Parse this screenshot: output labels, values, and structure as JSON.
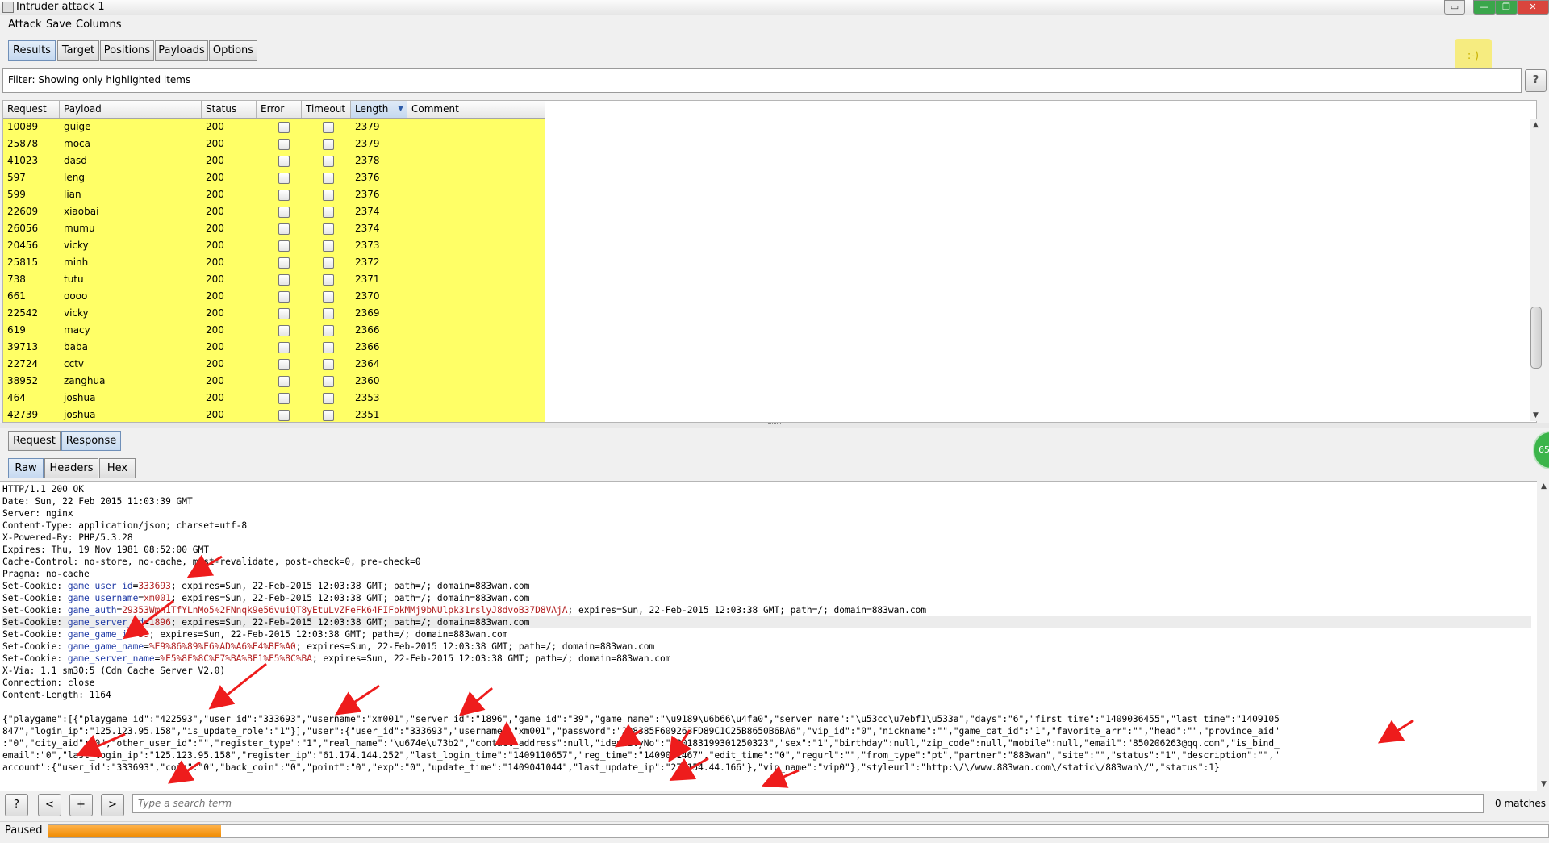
{
  "window": {
    "title": "Intruder attack 1"
  },
  "menu": [
    "Attack",
    "Save",
    "Columns"
  ],
  "tabs": [
    "Results",
    "Target",
    "Positions",
    "Payloads",
    "Options"
  ],
  "active_tab": "Results",
  "smiley": ":-)",
  "filter": {
    "text": "Filter: Showing only highlighted items",
    "help": "?"
  },
  "table": {
    "columns": [
      "Request",
      "Payload",
      "Status",
      "Error",
      "Timeout",
      "Length",
      "Comment"
    ],
    "sort_indicator": "▼",
    "highlight_color": "#ffff66",
    "rows": [
      {
        "request": "10089",
        "payload": "guige",
        "status": "200",
        "length": "2379"
      },
      {
        "request": "25878",
        "payload": "moca",
        "status": "200",
        "length": "2379"
      },
      {
        "request": "41023",
        "payload": "dasd",
        "status": "200",
        "length": "2378"
      },
      {
        "request": "597",
        "payload": "leng",
        "status": "200",
        "length": "2376"
      },
      {
        "request": "599",
        "payload": "lian",
        "status": "200",
        "length": "2376"
      },
      {
        "request": "22609",
        "payload": "xiaobai",
        "status": "200",
        "length": "2374"
      },
      {
        "request": "26056",
        "payload": "mumu",
        "status": "200",
        "length": "2374"
      },
      {
        "request": "20456",
        "payload": "vicky",
        "status": "200",
        "length": "2373"
      },
      {
        "request": "25815",
        "payload": "minh",
        "status": "200",
        "length": "2372"
      },
      {
        "request": "738",
        "payload": "tutu",
        "status": "200",
        "length": "2371"
      },
      {
        "request": "661",
        "payload": "oooo",
        "status": "200",
        "length": "2370"
      },
      {
        "request": "22542",
        "payload": "vicky",
        "status": "200",
        "length": "2369"
      },
      {
        "request": "619",
        "payload": "macy",
        "status": "200",
        "length": "2366"
      },
      {
        "request": "39713",
        "payload": "baba",
        "status": "200",
        "length": "2366"
      },
      {
        "request": "22724",
        "payload": "cctv",
        "status": "200",
        "length": "2364"
      },
      {
        "request": "38952",
        "payload": "zanghua",
        "status": "200",
        "length": "2360"
      },
      {
        "request": "464",
        "payload": "joshua",
        "status": "200",
        "length": "2353"
      },
      {
        "request": "42739",
        "payload": "joshua",
        "status": "200",
        "length": "2351"
      }
    ]
  },
  "lower_tabs": [
    "Request",
    "Response"
  ],
  "lower_active": "Response",
  "view_tabs": [
    "Raw",
    "Headers",
    "Hex"
  ],
  "view_active": "Raw",
  "badge": "65",
  "response": {
    "lines": [
      {
        "t": "HTTP/1.1 200 OK"
      },
      {
        "t": "Date: Sun, 22 Feb 2015 11:03:39 GMT"
      },
      {
        "t": "Server: nginx"
      },
      {
        "t": "Content-Type: application/json; charset=utf-8"
      },
      {
        "t": "X-Powered-By: PHP/5.3.28"
      },
      {
        "t": "Expires: Thu, 19 Nov 1981 08:52:00 GMT"
      },
      {
        "t": "Cache-Control: no-store, no-cache, must-revalidate, post-check=0, pre-check=0"
      },
      {
        "t": "Pragma: no-cache"
      },
      {
        "p": "Set-Cookie: ",
        "k": "game_user_id",
        "e": "=",
        "v": "333693",
        "s": "; expires=Sun, 22-Feb-2015 12:03:38 GMT; path=/; domain=883wan.com"
      },
      {
        "p": "Set-Cookie: ",
        "k": "game_username",
        "e": "=",
        "v": "xm001",
        "s": "; expires=Sun, 22-Feb-2015 12:03:38 GMT; path=/; domain=883wan.com"
      },
      {
        "p": "Set-Cookie: ",
        "k": "game_auth",
        "e": "=",
        "v": "29353WmH1TfYLnMo5%2FNnqk9e56vuiQT8yEtuLvZFeFk64FIFpkMMj9bNUlpk31rslyJ8dvoB37D8VAjA",
        "s": "; expires=Sun, 22-Feb-2015 12:03:38 GMT; path=/; domain=883wan.com"
      },
      {
        "p": "Set-Cookie: ",
        "k": "game_server_id",
        "e": "=",
        "v": "1896",
        "s": "; expires=Sun, 22-Feb-2015 12:03:38 GMT; path=/; domain=883wan.com",
        "hl": true
      },
      {
        "p": "Set-Cookie: ",
        "k": "game_game_id",
        "e": "=",
        "v": "39",
        "s": "; expires=Sun, 22-Feb-2015 12:03:38 GMT; path=/; domain=883wan.com"
      },
      {
        "p": "Set-Cookie: ",
        "k": "game_game_name",
        "e": "=",
        "v": "%E9%86%89%E6%AD%A6%E4%BE%A0",
        "s": "; expires=Sun, 22-Feb-2015 12:03:38 GMT; path=/; domain=883wan.com"
      },
      {
        "p": "Set-Cookie: ",
        "k": "game_server_name",
        "e": "=",
        "v": "%E5%8F%8C%E7%BA%BF1%E5%8C%BA",
        "s": "; expires=Sun, 22-Feb-2015 12:03:38 GMT; path=/; domain=883wan.com"
      },
      {
        "t": "X-Via: 1.1 sm30:5 (Cdn Cache Server V2.0)"
      },
      {
        "t": "Connection: close"
      },
      {
        "t": "Content-Length: 1164"
      },
      {
        "t": ""
      },
      {
        "t": "{\"playgame\":[{\"playgame_id\":\"422593\",\"user_id\":\"333693\",\"username\":\"xm001\",\"server_id\":\"1896\",\"game_id\":\"39\",\"game_name\":\"\\u9189\\u6b66\\u4fa0\",\"server_name\":\"\\u53cc\\u7ebf1\\u533a\",\"days\":\"6\",\"first_time\":\"1409036455\",\"last_time\":\"1409105"
      },
      {
        "t": "847\",\"login_ip\":\"125.123.95.158\",\"is_update_role\":\"1\"}],\"user\":{\"user_id\":\"333693\",\"username\":\"xm001\",\"password\":\"208385F609263FD89C1C25B8650B6BA6\",\"vip_id\":\"0\",\"nickname\":\"\",\"game_cat_id\":\"1\",\"favorite_arr\":\"\",\"head\":\"\",\"province_aid\""
      },
      {
        "t": ":\"0\",\"city_aid\":\"0\",\"other_user_id\":\"\",\"register_type\":\"1\",\"real_name\":\"\\u674e\\u73b2\",\"contact_address\":null,\"identityNo\":\"330183199301250323\",\"sex\":\"1\",\"birthday\":null,\"zip_code\":null,\"mobile\":null,\"email\":\"850206263@qq.com\",\"is_bind_"
      },
      {
        "t": "email\":\"0\",\"last_login_ip\":\"125.123.95.158\",\"register_ip\":\"61.174.144.252\",\"last_login_time\":\"1409110657\",\"reg_time\":\"1409031467\",\"edit_time\":\"0\",\"regurl\":\"\",\"from_type\":\"pt\",\"partner\":\"883wan\",\"site\":\"\",\"status\":\"1\",\"description\":\"\",\""
      },
      {
        "t": "account\":{\"user_id\":\"333693\",\"coin\":\"0\",\"back_coin\":\"0\",\"point\":\"0\",\"exp\":\"0\",\"update_time\":\"1409041044\",\"last_update_ip\":\"27.154.44.166\"},\"vip_name\":\"vip0\"},\"styleurl\":\"http:\\/\\/www.883wan.com\\/static\\/883wan\\/\",\"status\":1}"
      }
    ]
  },
  "search": {
    "buttons": [
      "?",
      "<",
      "+",
      ">"
    ],
    "placeholder": "Type a search term",
    "matches": "0 matches"
  },
  "status": {
    "text": "Paused",
    "progress": 0.115
  }
}
